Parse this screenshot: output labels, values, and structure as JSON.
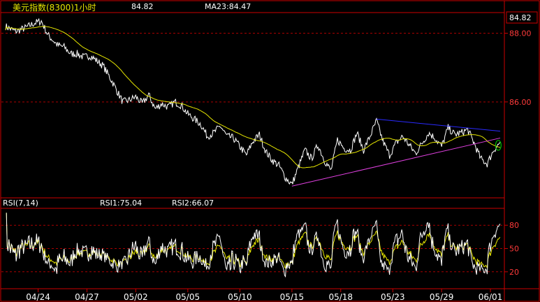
{
  "header": {
    "title": "美元指数(8300)1小时",
    "price": "84.82",
    "ma_label": "MA23:84.47"
  },
  "rsi_header": {
    "label": "RSI(7,14)",
    "rsi1": "RSI1:75.04",
    "rsi2": "RSI2:66.07"
  },
  "colors": {
    "background": "#000000",
    "frame": "#cc0000",
    "grid": "#aa0000",
    "price_line": "#ffffff",
    "ma_line": "#e6e600",
    "rsi1_line": "#ffffff",
    "rsi2_line": "#e6e600",
    "resistance_trendline": "#2a2aff",
    "support_trendline": "#e040e0",
    "last_marker": "#00c000",
    "axis_text": "#ff3a3a",
    "header_text": "#ffffff",
    "title_text": "#e6e600",
    "tick_text": "#ffffff"
  },
  "chart_data": [
    {
      "type": "line",
      "panel": "price",
      "y_ticks": [
        "88.00",
        "86.00"
      ],
      "y_tick_values": [
        88.0,
        86.0
      ],
      "last_value_label": "84.82",
      "ylim": [
        83.25,
        88.6
      ],
      "x_tick_labels": [
        "04/24",
        "04/27",
        "05/02",
        "05/05",
        "05/10",
        "05/15",
        "05/18",
        "05/23",
        "05/29",
        "06/01"
      ],
      "x_tick_index": [
        10,
        25,
        40,
        56,
        72,
        88,
        103,
        119,
        134,
        149
      ],
      "x_range": [
        0,
        152
      ],
      "grid": true,
      "price_anchors": [
        [
          0,
          88.2
        ],
        [
          3,
          88.05
        ],
        [
          6,
          88.15
        ],
        [
          9,
          88.3
        ],
        [
          11,
          88.35
        ],
        [
          13,
          87.95
        ],
        [
          16,
          87.65
        ],
        [
          18,
          87.6
        ],
        [
          20,
          87.4
        ],
        [
          22,
          87.4
        ],
        [
          24,
          87.3
        ],
        [
          26,
          87.35
        ],
        [
          28,
          87.2
        ],
        [
          30,
          87.05
        ],
        [
          33,
          86.55
        ],
        [
          36,
          86.0
        ],
        [
          38,
          86.05
        ],
        [
          40,
          86.15
        ],
        [
          42,
          85.95
        ],
        [
          44,
          86.2
        ],
        [
          46,
          85.8
        ],
        [
          48,
          85.95
        ],
        [
          50,
          85.85
        ],
        [
          52,
          86.0
        ],
        [
          54,
          85.9
        ],
        [
          56,
          85.65
        ],
        [
          58,
          85.5
        ],
        [
          60,
          85.35
        ],
        [
          62,
          85.0
        ],
        [
          64,
          85.1
        ],
        [
          66,
          85.3
        ],
        [
          68,
          85.0
        ],
        [
          70,
          84.95
        ],
        [
          72,
          84.7
        ],
        [
          74,
          84.45
        ],
        [
          76,
          84.85
        ],
        [
          78,
          85.05
        ],
        [
          80,
          84.55
        ],
        [
          82,
          84.3
        ],
        [
          84,
          84.15
        ],
        [
          86,
          83.8
        ],
        [
          88,
          83.6
        ],
        [
          90,
          84.1
        ],
        [
          92,
          84.6
        ],
        [
          94,
          84.35
        ],
        [
          96,
          84.75
        ],
        [
          98,
          84.3
        ],
        [
          100,
          84.0
        ],
        [
          102,
          84.9
        ],
        [
          104,
          84.65
        ],
        [
          106,
          84.6
        ],
        [
          108,
          85.1
        ],
        [
          110,
          84.6
        ],
        [
          112,
          85.0
        ],
        [
          114,
          85.45
        ],
        [
          116,
          84.85
        ],
        [
          118,
          84.45
        ],
        [
          120,
          84.8
        ],
        [
          122,
          85.0
        ],
        [
          124,
          84.75
        ],
        [
          126,
          84.5
        ],
        [
          128,
          84.8
        ],
        [
          130,
          85.1
        ],
        [
          132,
          84.95
        ],
        [
          134,
          84.7
        ],
        [
          136,
          85.25
        ],
        [
          138,
          85.05
        ],
        [
          140,
          85.1
        ],
        [
          142,
          85.2
        ],
        [
          144,
          84.8
        ],
        [
          146,
          84.35
        ],
        [
          148,
          84.2
        ],
        [
          150,
          84.6
        ],
        [
          152,
          84.82
        ]
      ],
      "ma_period": 23,
      "trendlines": [
        {
          "name": "resistance",
          "from": [
            114,
            85.5
          ],
          "to": [
            152,
            85.15
          ]
        },
        {
          "name": "support",
          "from": [
            88,
            83.55
          ],
          "to": [
            152,
            84.95
          ]
        }
      ],
      "last_marker": [
        151,
        84.82
      ]
    },
    {
      "type": "line",
      "panel": "rsi",
      "series": [
        {
          "name": "RSI1",
          "last": 75.04
        },
        {
          "name": "RSI2",
          "last": 66.07
        }
      ],
      "y_ticks": [
        "80",
        "50",
        "20"
      ],
      "y_tick_values": [
        80,
        50,
        20
      ],
      "ylim": [
        0,
        100
      ],
      "grid": true
    }
  ]
}
